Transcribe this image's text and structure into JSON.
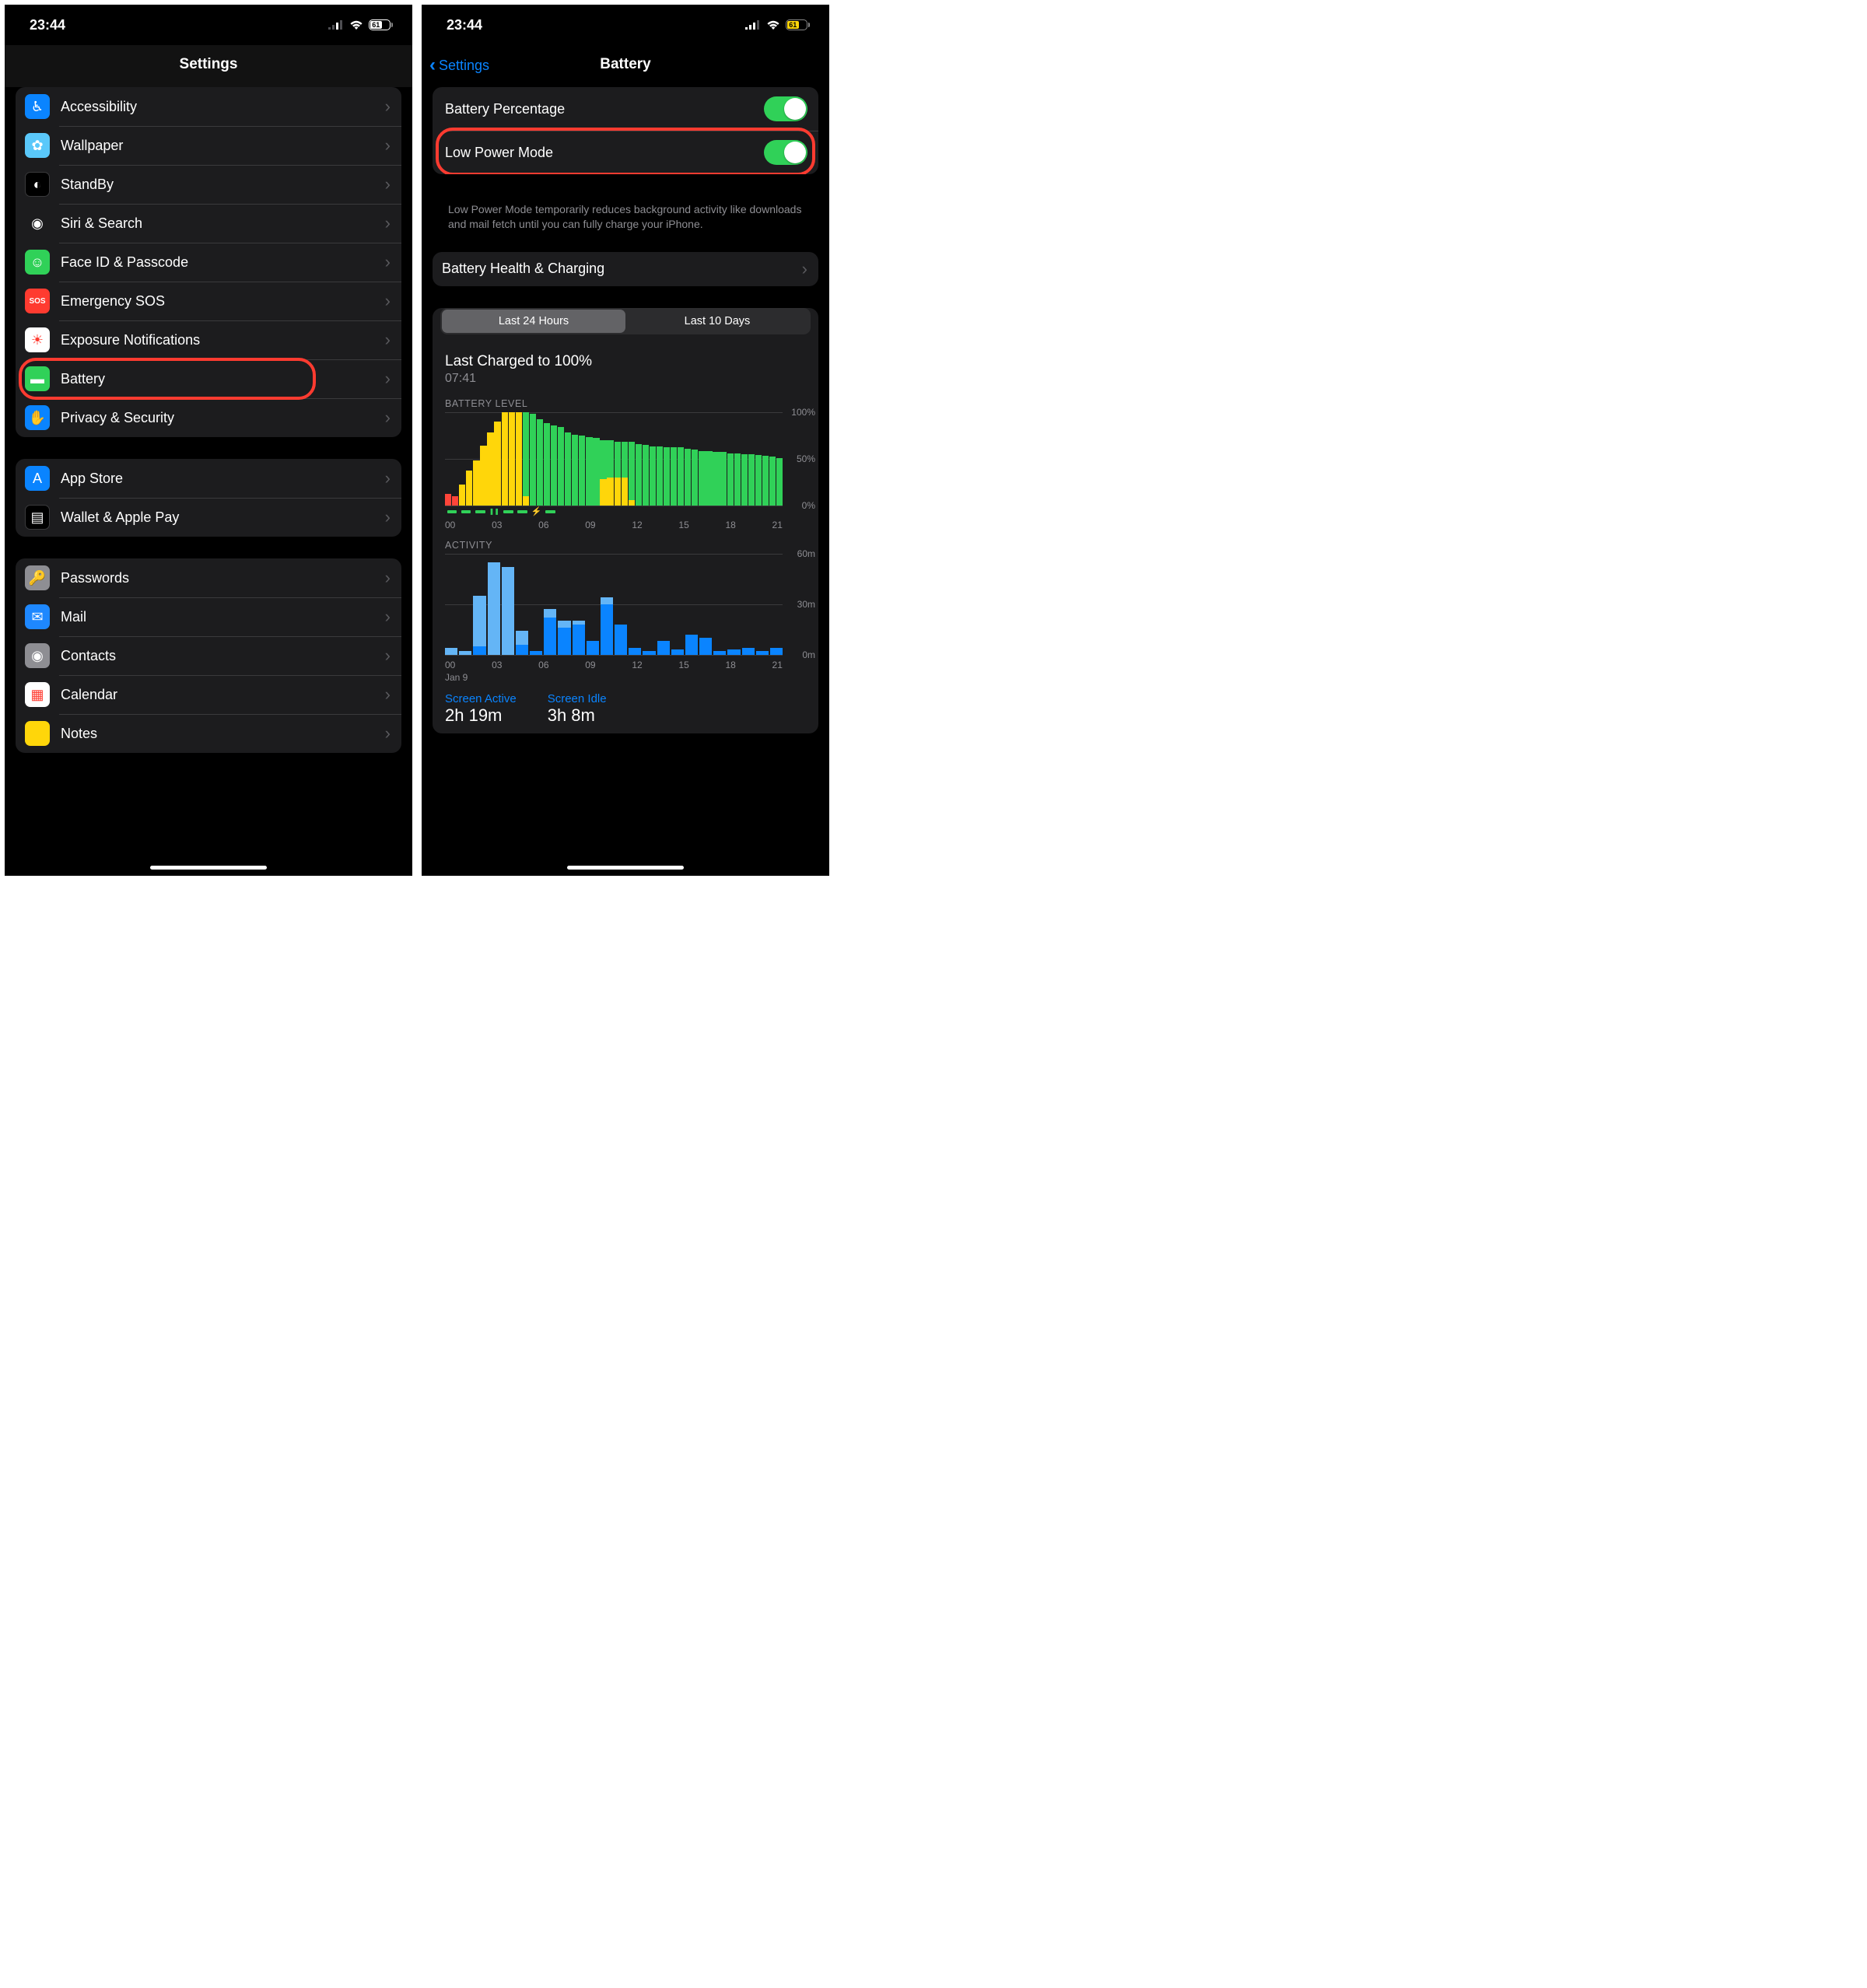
{
  "left": {
    "status": {
      "time": "23:44",
      "battery": "61"
    },
    "nav_title": "Settings",
    "groups": [
      [
        {
          "id": "accessibility",
          "label": "Accessibility",
          "icon_bg": "#0a84ff",
          "glyph": "♿︎"
        },
        {
          "id": "wallpaper",
          "label": "Wallpaper",
          "icon_bg": "#5ac8fa",
          "glyph": "✿"
        },
        {
          "id": "standby",
          "label": "StandBy",
          "icon_bg": "#000",
          "glyph": "◐",
          "border": true
        },
        {
          "id": "siri",
          "label": "Siri & Search",
          "icon_bg": "#1c1c1e",
          "glyph": "◉"
        },
        {
          "id": "faceid",
          "label": "Face ID & Passcode",
          "icon_bg": "#30d158",
          "glyph": "☺"
        },
        {
          "id": "sos",
          "label": "Emergency SOS",
          "icon_bg": "#ff3b30",
          "glyph": "SOS",
          "small": true
        },
        {
          "id": "exposure",
          "label": "Exposure Notifications",
          "icon_bg": "#fff",
          "glyph": "☀",
          "fg": "#ff3b30"
        },
        {
          "id": "battery",
          "label": "Battery",
          "icon_bg": "#30d158",
          "glyph": "▬",
          "highlight": true
        },
        {
          "id": "privacy",
          "label": "Privacy & Security",
          "icon_bg": "#0a84ff",
          "glyph": "✋"
        }
      ],
      [
        {
          "id": "appstore",
          "label": "App Store",
          "icon_bg": "#0a84ff",
          "glyph": "A"
        },
        {
          "id": "wallet",
          "label": "Wallet & Apple Pay",
          "icon_bg": "#000",
          "glyph": "▤",
          "border": true
        }
      ],
      [
        {
          "id": "passwords",
          "label": "Passwords",
          "icon_bg": "#8e8e93",
          "glyph": "🔑"
        },
        {
          "id": "mail",
          "label": "Mail",
          "icon_bg": "#1e88ff",
          "glyph": "✉"
        },
        {
          "id": "contacts",
          "label": "Contacts",
          "icon_bg": "#8e8e93",
          "glyph": "◉"
        },
        {
          "id": "calendar",
          "label": "Calendar",
          "icon_bg": "#fff",
          "glyph": "▦",
          "fg": "#ff3b30"
        },
        {
          "id": "notes",
          "label": "Notes",
          "icon_bg": "#ffd60a",
          "glyph": ""
        }
      ]
    ]
  },
  "right": {
    "status": {
      "time": "23:44",
      "battery": "61"
    },
    "back_label": "Settings",
    "nav_title": "Battery",
    "toggles": [
      {
        "id": "battpct",
        "label": "Battery Percentage",
        "on": true
      },
      {
        "id": "lowpower",
        "label": "Low Power Mode",
        "on": true,
        "highlight": true
      }
    ],
    "footnote": "Low Power Mode temporarily reduces background activity like downloads and mail fetch until you can fully charge your iPhone.",
    "health_label": "Battery Health & Charging",
    "segments": {
      "a": "Last 24 Hours",
      "b": "Last 10 Days",
      "active": "a"
    },
    "last_charged": {
      "title": "Last Charged to 100%",
      "sub": "07:41"
    },
    "battery_level_label": "BATTERY LEVEL",
    "activity_label": "ACTIVITY",
    "xaxis_hours": [
      "00",
      "03",
      "06",
      "09",
      "12",
      "15",
      "18",
      "21"
    ],
    "month_label": "Jan 9",
    "ylabels_level": [
      "100%",
      "50%",
      "0%"
    ],
    "ylabels_activity": [
      "60m",
      "30m",
      "0m"
    ],
    "summary": {
      "active_label": "Screen Active",
      "active_val": "2h 19m",
      "idle_label": "Screen Idle",
      "idle_val": "3h 8m"
    }
  },
  "chart_data": {
    "type": "bar",
    "battery_level": {
      "ylim": [
        0,
        100
      ],
      "bars": [
        {
          "green": 0,
          "yellow": 0,
          "red": 12
        },
        {
          "green": 0,
          "yellow": 0,
          "red": 10
        },
        {
          "green": 0,
          "yellow": 22,
          "red": 0
        },
        {
          "green": 0,
          "yellow": 37,
          "red": 0
        },
        {
          "green": 0,
          "yellow": 48,
          "red": 0
        },
        {
          "green": 0,
          "yellow": 64,
          "red": 0
        },
        {
          "green": 0,
          "yellow": 78,
          "red": 0
        },
        {
          "green": 0,
          "yellow": 90,
          "red": 0
        },
        {
          "green": 0,
          "yellow": 100,
          "red": 0
        },
        {
          "green": 0,
          "yellow": 100,
          "red": 0
        },
        {
          "green": 0,
          "yellow": 100,
          "red": 0
        },
        {
          "green": 90,
          "yellow": 10,
          "red": 0
        },
        {
          "green": 98,
          "yellow": 0,
          "red": 0
        },
        {
          "green": 92,
          "yellow": 0,
          "red": 0
        },
        {
          "green": 88,
          "yellow": 0,
          "red": 0
        },
        {
          "green": 86,
          "yellow": 0,
          "red": 0
        },
        {
          "green": 84,
          "yellow": 0,
          "red": 0
        },
        {
          "green": 78,
          "yellow": 0,
          "red": 0
        },
        {
          "green": 76,
          "yellow": 0,
          "red": 0
        },
        {
          "green": 75,
          "yellow": 0,
          "red": 0
        },
        {
          "green": 73,
          "yellow": 0,
          "red": 0
        },
        {
          "green": 72,
          "yellow": 0,
          "red": 0
        },
        {
          "green": 42,
          "yellow": 28,
          "red": 0
        },
        {
          "green": 40,
          "yellow": 30,
          "red": 0
        },
        {
          "green": 38,
          "yellow": 30,
          "red": 0
        },
        {
          "green": 38,
          "yellow": 30,
          "red": 0
        },
        {
          "green": 62,
          "yellow": 6,
          "red": 0
        },
        {
          "green": 66,
          "yellow": 0,
          "red": 0
        },
        {
          "green": 65,
          "yellow": 0,
          "red": 0
        },
        {
          "green": 63,
          "yellow": 0,
          "red": 0
        },
        {
          "green": 63,
          "yellow": 0,
          "red": 0
        },
        {
          "green": 62,
          "yellow": 0,
          "red": 0
        },
        {
          "green": 62,
          "yellow": 0,
          "red": 0
        },
        {
          "green": 62,
          "yellow": 0,
          "red": 0
        },
        {
          "green": 61,
          "yellow": 0,
          "red": 0
        },
        {
          "green": 60,
          "yellow": 0,
          "red": 0
        },
        {
          "green": 58,
          "yellow": 0,
          "red": 0
        },
        {
          "green": 58,
          "yellow": 0,
          "red": 0
        },
        {
          "green": 57,
          "yellow": 0,
          "red": 0
        },
        {
          "green": 57,
          "yellow": 0,
          "red": 0
        },
        {
          "green": 56,
          "yellow": 0,
          "red": 0
        },
        {
          "green": 56,
          "yellow": 0,
          "red": 0
        },
        {
          "green": 55,
          "yellow": 0,
          "red": 0
        },
        {
          "green": 55,
          "yellow": 0,
          "red": 0
        },
        {
          "green": 54,
          "yellow": 0,
          "red": 0
        },
        {
          "green": 53,
          "yellow": 0,
          "red": 0
        },
        {
          "green": 52,
          "yellow": 0,
          "red": 0
        },
        {
          "green": 51,
          "yellow": 0,
          "red": 0
        }
      ],
      "charging_hours": [
        "00-bar",
        "01-bar",
        "02-bar",
        "03-pause",
        "04-bar",
        "05-bar",
        "06-bolt",
        "07-bar"
      ]
    },
    "activity": {
      "ylim": [
        0,
        60
      ],
      "bars": [
        {
          "light": 4,
          "dark": 0
        },
        {
          "light": 2,
          "dark": 0
        },
        {
          "light": 30,
          "dark": 5
        },
        {
          "light": 55,
          "dark": 0
        },
        {
          "light": 52,
          "dark": 0
        },
        {
          "light": 8,
          "dark": 6
        },
        {
          "light": 0,
          "dark": 2
        },
        {
          "light": 5,
          "dark": 22
        },
        {
          "light": 4,
          "dark": 16
        },
        {
          "light": 2,
          "dark": 18
        },
        {
          "light": 0,
          "dark": 8
        },
        {
          "light": 4,
          "dark": 30
        },
        {
          "light": 0,
          "dark": 18
        },
        {
          "light": 0,
          "dark": 4
        },
        {
          "light": 0,
          "dark": 2
        },
        {
          "light": 0,
          "dark": 8
        },
        {
          "light": 0,
          "dark": 3
        },
        {
          "light": 0,
          "dark": 12
        },
        {
          "light": 0,
          "dark": 10
        },
        {
          "light": 0,
          "dark": 2
        },
        {
          "light": 0,
          "dark": 3
        },
        {
          "light": 0,
          "dark": 4
        },
        {
          "light": 0,
          "dark": 2
        },
        {
          "light": 0,
          "dark": 4
        }
      ]
    }
  }
}
